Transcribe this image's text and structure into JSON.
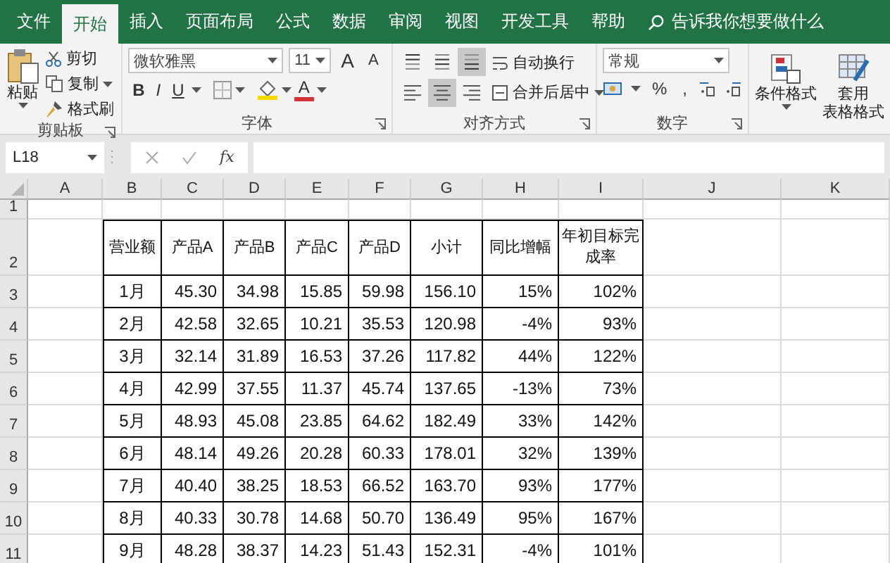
{
  "ribbon_tabs": [
    {
      "label": "文件",
      "selected": false
    },
    {
      "label": "开始",
      "selected": true
    },
    {
      "label": "插入",
      "selected": false
    },
    {
      "label": "页面布局",
      "selected": false
    },
    {
      "label": "公式",
      "selected": false
    },
    {
      "label": "数据",
      "selected": false
    },
    {
      "label": "审阅",
      "selected": false
    },
    {
      "label": "视图",
      "selected": false
    },
    {
      "label": "开发工具",
      "selected": false
    },
    {
      "label": "帮助",
      "selected": false
    }
  ],
  "tell_me": {
    "text": "告诉我你想要做什么"
  },
  "clipboard": {
    "paste": "粘贴",
    "cut": "剪切",
    "copy": "复制",
    "format_painter": "格式刷",
    "label": "剪贴板"
  },
  "font": {
    "name": "微软雅黑",
    "size": "11",
    "grow": "A",
    "shrink": "A",
    "bold": "B",
    "italic": "I",
    "underline": "U",
    "font_color": "A",
    "label": "字体"
  },
  "alignment": {
    "vertical": [
      {
        "selected": false
      },
      {
        "selected": false
      },
      {
        "selected": true
      }
    ],
    "horizontal": [
      {
        "selected": false
      },
      {
        "selected": true
      },
      {
        "selected": false
      }
    ],
    "wrap_text": "自动换行",
    "merge_center": "合并后居中",
    "label": "对齐方式"
  },
  "number": {
    "format": "常规",
    "percent": "%",
    "comma": ",",
    "label": "数字"
  },
  "styles": {
    "conditional_format": "条件格式",
    "format_as_table": [
      "套用",
      "表格格式"
    ]
  },
  "formula_bar": {
    "name_box": "L18",
    "fx": "fx"
  },
  "sheet": {
    "columns": [
      "A",
      "B",
      "C",
      "D",
      "E",
      "F",
      "G",
      "H",
      "I",
      "J",
      "K"
    ],
    "rows": [
      "1",
      "2",
      "3",
      "4",
      "5",
      "6",
      "7",
      "8",
      "9",
      "10",
      "11"
    ]
  },
  "table": {
    "header": [
      "营业额",
      "产品A",
      "产品B",
      "产品C",
      "产品D",
      "小计",
      "同比增幅",
      "年初目标完成率"
    ],
    "rows": [
      [
        "1月",
        "45.30",
        "34.98",
        "15.85",
        "59.98",
        "156.10",
        "15%",
        "102%"
      ],
      [
        "2月",
        "42.58",
        "32.65",
        "10.21",
        "35.53",
        "120.98",
        "-4%",
        "93%"
      ],
      [
        "3月",
        "32.14",
        "31.89",
        "16.53",
        "37.26",
        "117.82",
        "44%",
        "122%"
      ],
      [
        "4月",
        "42.99",
        "37.55",
        "11.37",
        "45.74",
        "137.65",
        "-13%",
        "73%"
      ],
      [
        "5月",
        "48.93",
        "45.08",
        "23.85",
        "64.62",
        "182.49",
        "33%",
        "142%"
      ],
      [
        "6月",
        "48.14",
        "49.26",
        "20.28",
        "60.33",
        "178.01",
        "32%",
        "139%"
      ],
      [
        "7月",
        "40.40",
        "38.25",
        "18.53",
        "66.52",
        "163.70",
        "93%",
        "177%"
      ],
      [
        "8月",
        "40.33",
        "30.78",
        "14.68",
        "50.70",
        "136.49",
        "95%",
        "167%"
      ],
      [
        "9月",
        "48.28",
        "38.37",
        "14.23",
        "51.43",
        "152.31",
        "-4%",
        "101%"
      ]
    ]
  }
}
